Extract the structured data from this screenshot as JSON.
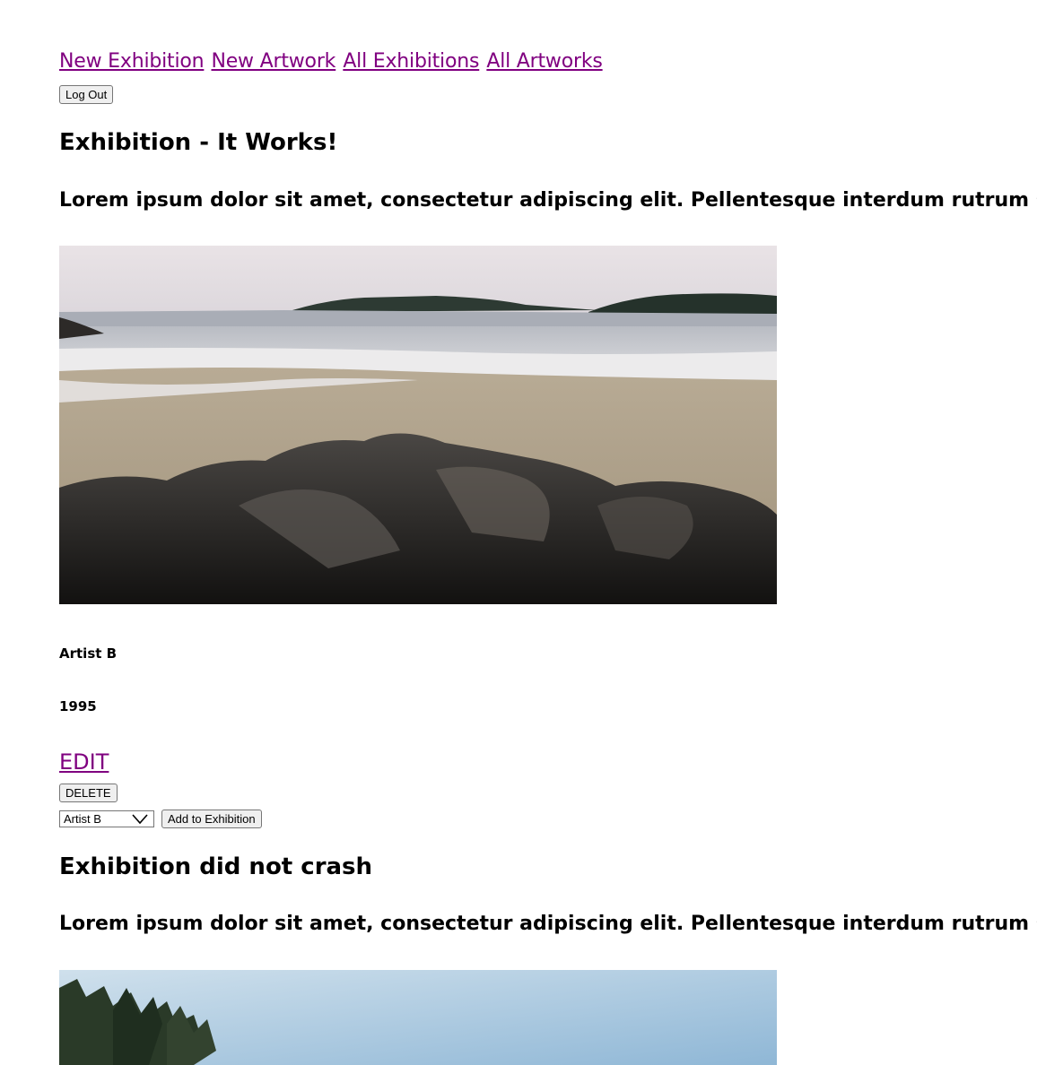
{
  "nav": {
    "links": [
      "New Exhibition",
      "New Artwork",
      "All Exhibitions",
      "All Artworks"
    ],
    "logout_label": "Log Out",
    "link_color": "#800080"
  },
  "exhibitions": [
    {
      "title": "Exhibition - It Works!",
      "description": "Lorem ipsum dolor sit amet, consectetur adipiscing elit. Pellentesque interdum rutrum sodales.",
      "artist": "Artist B",
      "year": "1995",
      "edit_label": "EDIT",
      "delete_label": "DELETE",
      "select_value": "Artist B",
      "add_label": "Add to Exhibition",
      "image": "beach-rocks-photo"
    },
    {
      "title": "Exhibition did not crash",
      "description": "Lorem ipsum dolor sit amet, consectetur adipiscing elit. Pellentesque interdum rutrum sodales.",
      "image": "forest-sky-photo"
    }
  ]
}
